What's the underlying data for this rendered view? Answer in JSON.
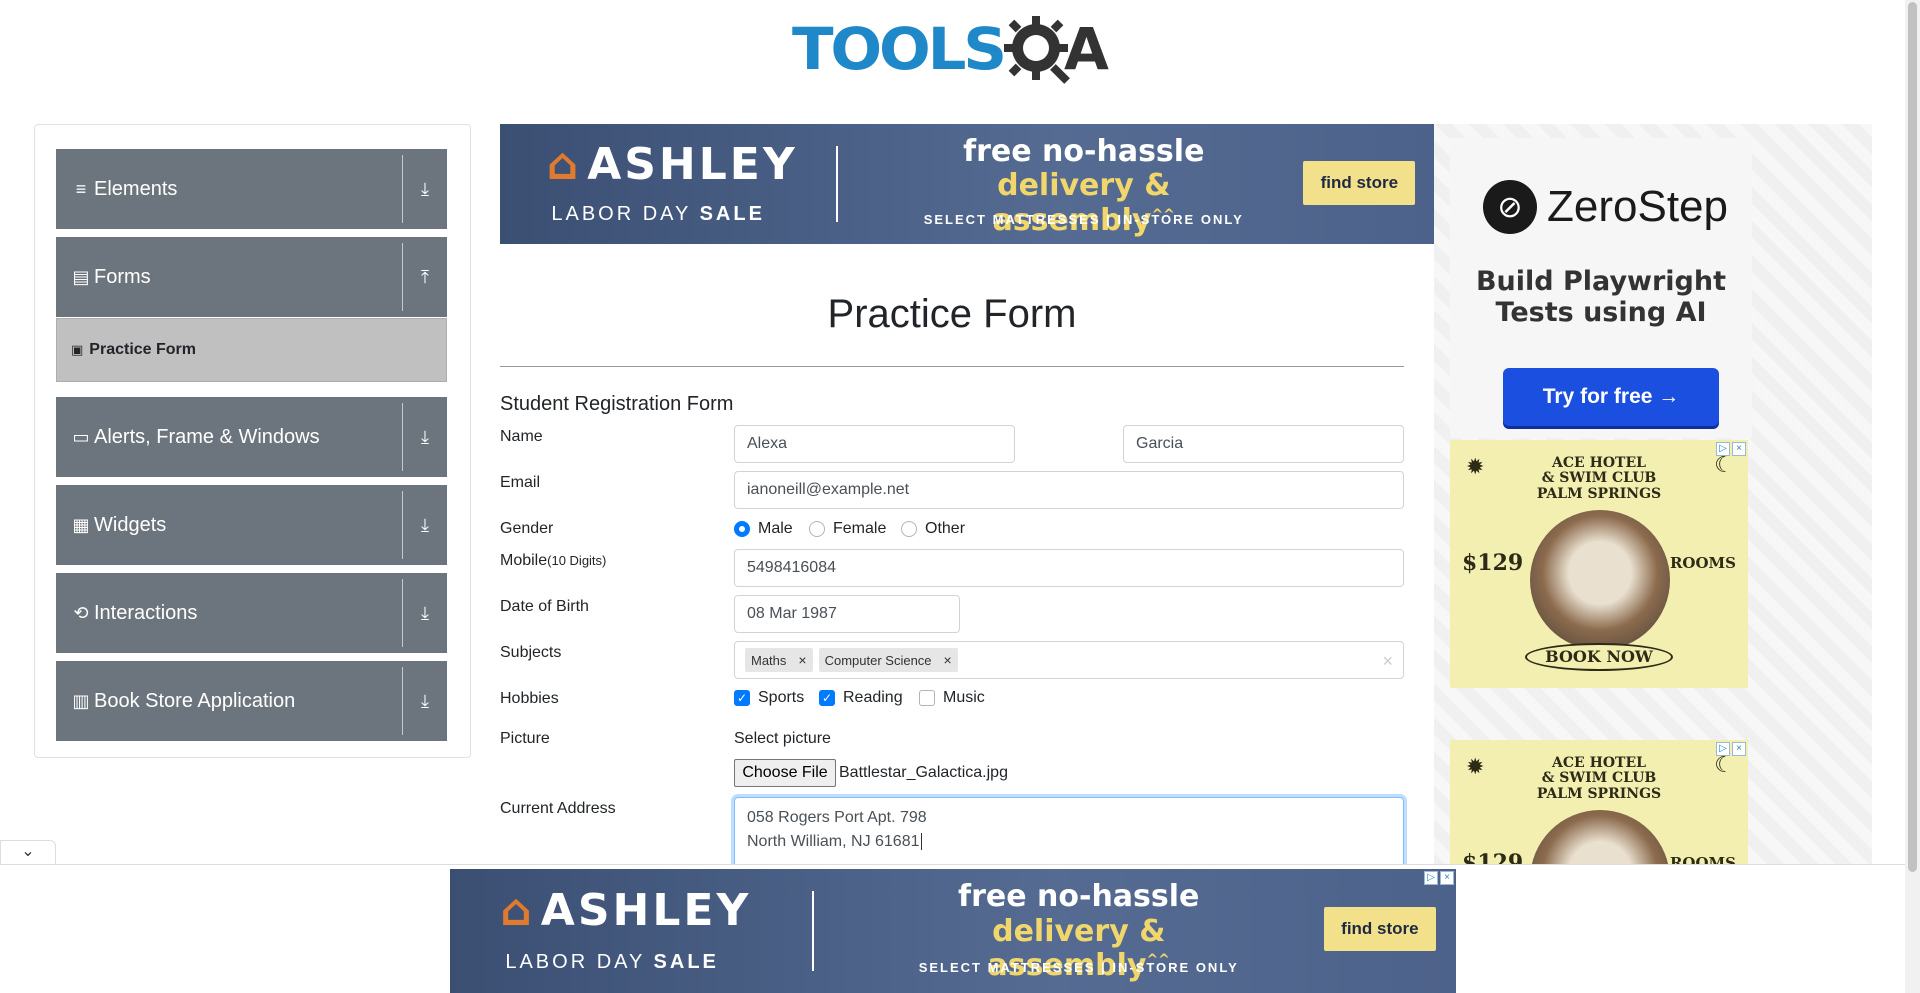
{
  "header": {
    "logo_text": "TOOLS",
    "logo_a": "A"
  },
  "sidebar": {
    "groups": [
      {
        "label": "Elements",
        "icon": "≡",
        "arrow": "⤓"
      },
      {
        "label": "Forms",
        "icon": "▤",
        "arrow": "⤒"
      },
      {
        "label": "Alerts, Frame & Windows",
        "icon": "▭",
        "arrow": "⤓"
      },
      {
        "label": "Widgets",
        "icon": "▦",
        "arrow": "⤓"
      },
      {
        "label": "Interactions",
        "icon": "⟲",
        "arrow": "⤓"
      },
      {
        "label": "Book Store Application",
        "icon": "▥",
        "arrow": "⤓"
      }
    ],
    "active_item": {
      "label": "Practice Form",
      "icon": "▣"
    }
  },
  "ads": {
    "ashley": {
      "brand": "ASHLEY",
      "sale_prefix": "LABOR DAY ",
      "sale_bold": "SALE",
      "line1": "free no-hassle",
      "line2": "delivery & assembly",
      "sup": "^^",
      "note": "SELECT MATTRESSES | IN-STORE ONLY",
      "button": "find store"
    },
    "zerostep": {
      "name": "ZeroStep",
      "tagline": "Build Playwright Tests using AI",
      "button": "Try for free →"
    },
    "ace": {
      "title_l1": "ACE HOTEL",
      "title_l2": "& SWIM CLUB",
      "title_l3": "PALM SPRINGS",
      "price": "$129",
      "rooms": "ROOMS",
      "button": "BOOK NOW"
    }
  },
  "form": {
    "title": "Practice Form",
    "subtitle": "Student Registration Form",
    "name_label": "Name",
    "first_name": "Alexa",
    "last_name": "Garcia",
    "email_label": "Email",
    "email": "ianoneill@example.net",
    "gender_label": "Gender",
    "genders": [
      "Male",
      "Female",
      "Other"
    ],
    "gender_selected": "Male",
    "mobile_label": "Mobile",
    "mobile_hint": "(10 Digits)",
    "mobile": "5498416084",
    "dob_label": "Date of Birth",
    "dob": "08 Mar 1987",
    "subjects_label": "Subjects",
    "subjects": [
      "Maths",
      "Computer Science"
    ],
    "hobbies_label": "Hobbies",
    "hobbies": [
      {
        "label": "Sports",
        "checked": true
      },
      {
        "label": "Reading",
        "checked": true
      },
      {
        "label": "Music",
        "checked": false
      }
    ],
    "picture_label": "Picture",
    "select_picture": "Select picture",
    "choose_file": "Choose File",
    "file_name": "Battlestar_Galactica.jpg",
    "address_label": "Current Address",
    "address_l1": "058 Rogers Port Apt. 798",
    "address_l2": "North William, NJ 61681"
  },
  "colors": {
    "primary": "#007bff",
    "sidebar_group": "#6c757d",
    "active_item": "#c0c0c0"
  }
}
